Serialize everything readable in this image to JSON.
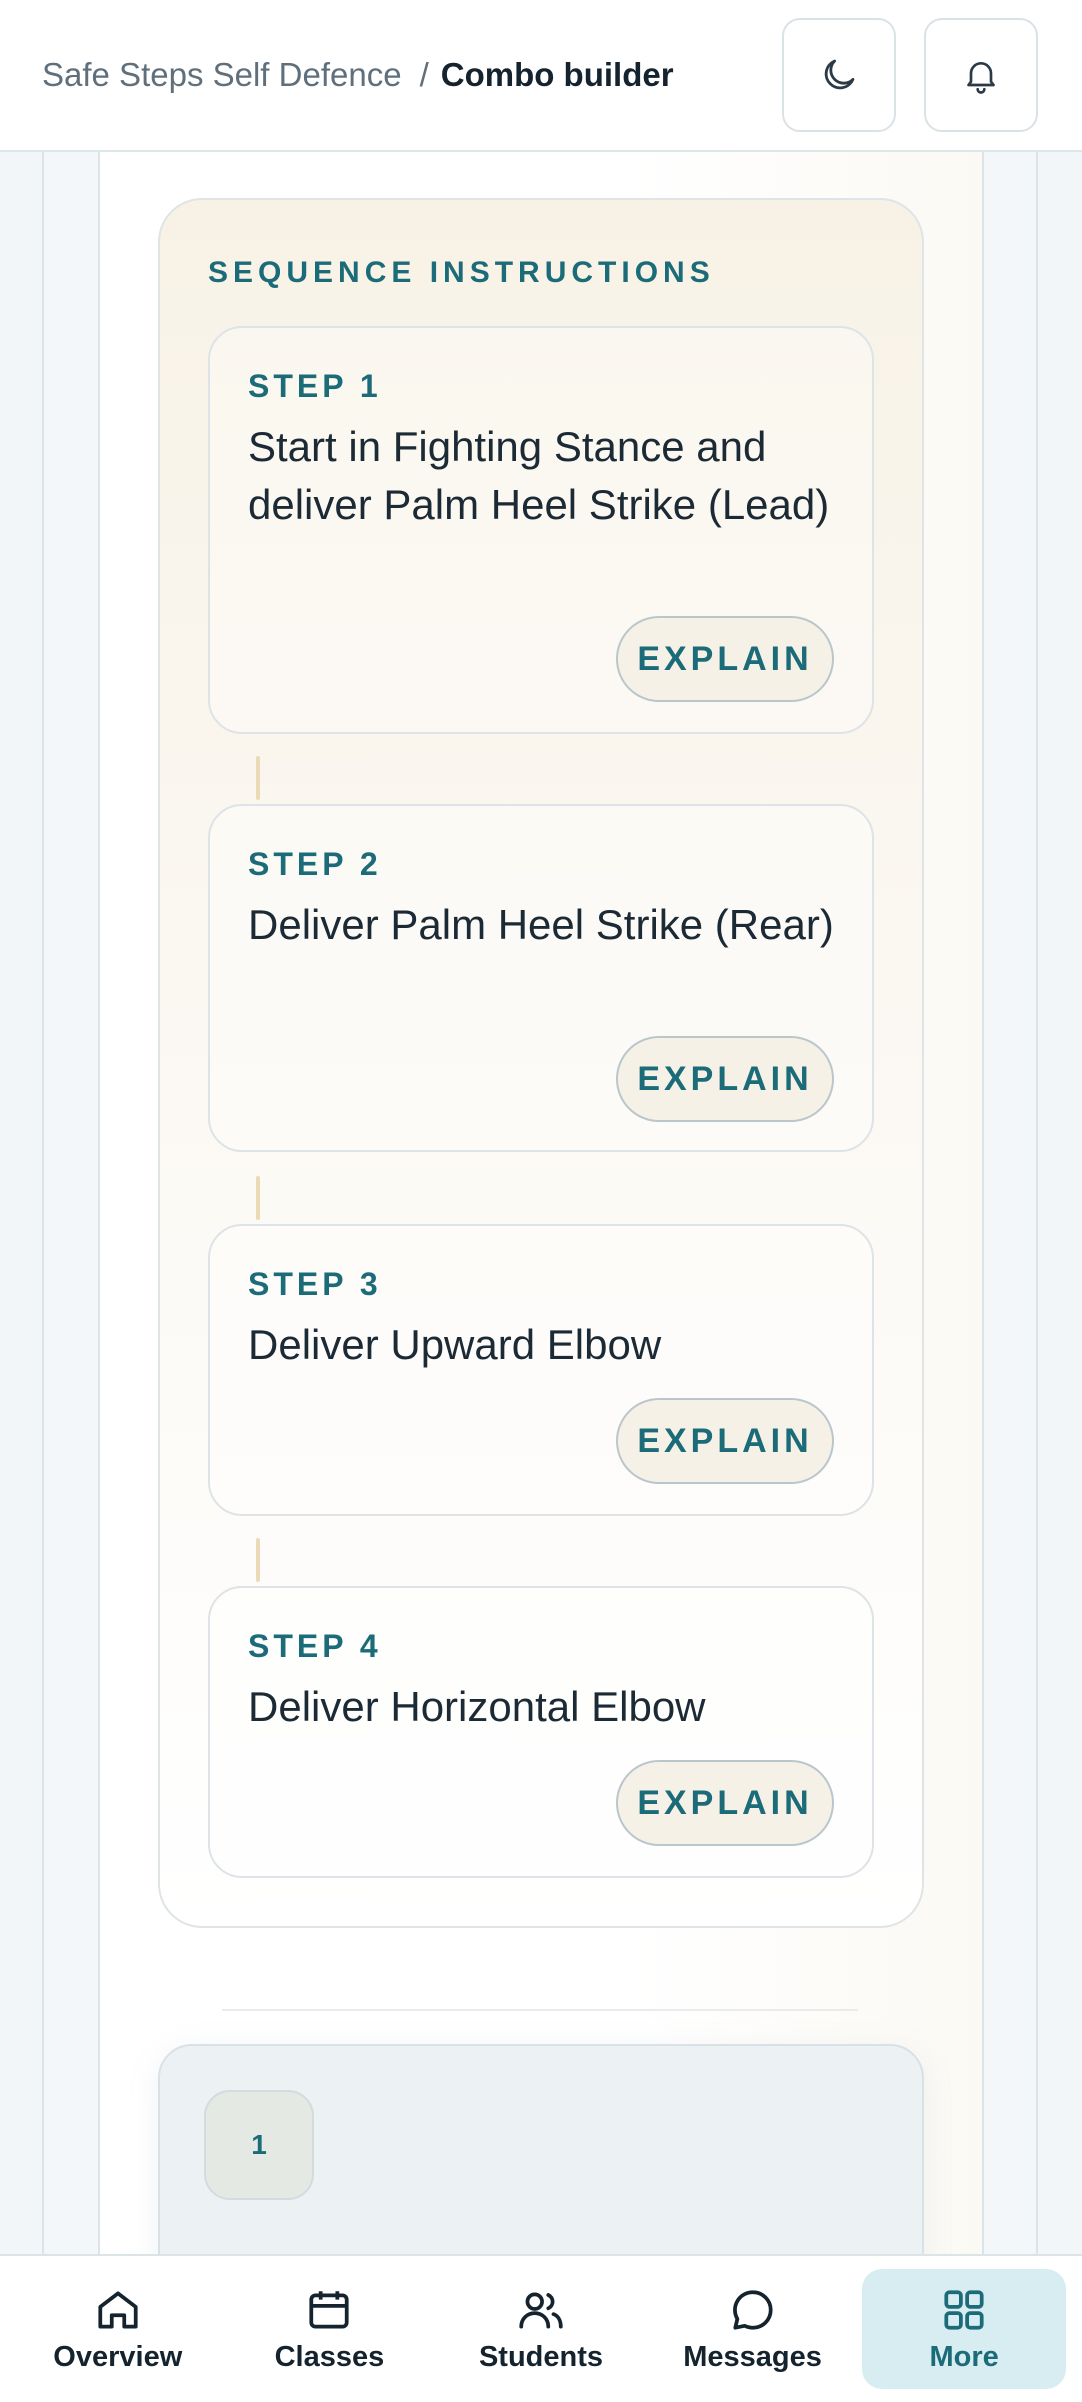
{
  "header": {
    "breadcrumb_parent": "Safe Steps Self Defence",
    "separator": "/",
    "breadcrumb_current": "Combo builder",
    "theme_toggle_icon": "moon-icon",
    "notifications_icon": "bell-icon"
  },
  "sequence": {
    "title": "SEQUENCE INSTRUCTIONS",
    "steps": [
      {
        "label": "STEP 1",
        "text": "Start in Fighting Stance and deliver Palm Heel Strike (Lead)",
        "button": "EXPLAIN"
      },
      {
        "label": "STEP 2",
        "text": "Deliver Palm Heel Strike (Rear)",
        "button": "EXPLAIN"
      },
      {
        "label": "STEP 3",
        "text": "Deliver Upward Elbow",
        "button": "EXPLAIN"
      },
      {
        "label": "STEP 4",
        "text": "Deliver Horizontal Elbow",
        "button": "EXPLAIN"
      }
    ]
  },
  "next_section": {
    "badge": "1"
  },
  "nav": {
    "items": [
      {
        "label": "Overview",
        "icon": "home-icon"
      },
      {
        "label": "Classes",
        "icon": "calendar-icon"
      },
      {
        "label": "Students",
        "icon": "users-icon"
      },
      {
        "label": "Messages",
        "icon": "chat-icon"
      },
      {
        "label": "More",
        "icon": "grid-icon"
      }
    ],
    "active": "More"
  },
  "colors": {
    "accent": "#1b6b78",
    "active_nav_bg": "#d8edf1",
    "card_warm": "#f8f2e6"
  }
}
